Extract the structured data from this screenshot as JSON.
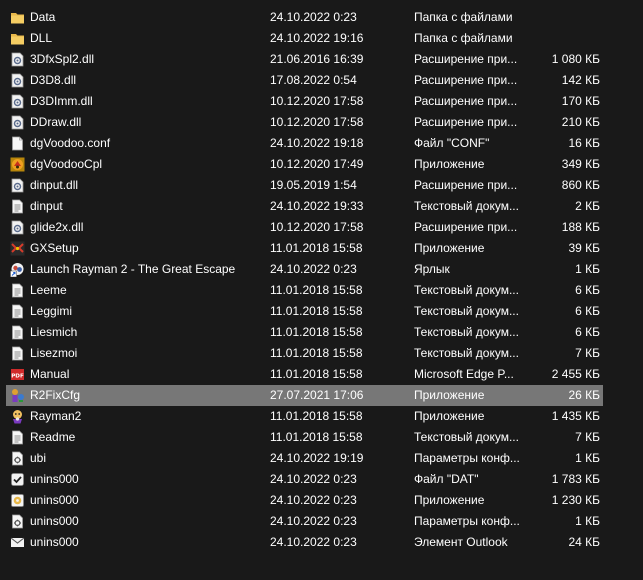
{
  "files": [
    {
      "name": "Data",
      "date": "24.10.2022 0:23",
      "type": "Папка с файлами",
      "size": "",
      "icon": "folder-icon"
    },
    {
      "name": "DLL",
      "date": "24.10.2022 19:16",
      "type": "Папка с файлами",
      "size": "",
      "icon": "folder-icon"
    },
    {
      "name": "3DfxSpl2.dll",
      "date": "21.06.2016 16:39",
      "type": "Расширение при...",
      "size": "1 080 КБ",
      "icon": "dll-file-icon"
    },
    {
      "name": "D3D8.dll",
      "date": "17.08.2022 0:54",
      "type": "Расширение при...",
      "size": "142 КБ",
      "icon": "dll-file-icon"
    },
    {
      "name": "D3DImm.dll",
      "date": "10.12.2020 17:58",
      "type": "Расширение при...",
      "size": "170 КБ",
      "icon": "dll-file-icon"
    },
    {
      "name": "DDraw.dll",
      "date": "10.12.2020 17:58",
      "type": "Расширение при...",
      "size": "210 КБ",
      "icon": "dll-file-icon"
    },
    {
      "name": "dgVoodoo.conf",
      "date": "24.10.2022 19:18",
      "type": "Файл \"CONF\"",
      "size": "16 КБ",
      "icon": "blank-file-icon"
    },
    {
      "name": "dgVoodooCpl",
      "date": "10.12.2020 17:49",
      "type": "Приложение",
      "size": "349 КБ",
      "icon": "dgvoodoo-app-icon"
    },
    {
      "name": "dinput.dll",
      "date": "19.05.2019 1:54",
      "type": "Расширение при...",
      "size": "860 КБ",
      "icon": "dll-file-icon"
    },
    {
      "name": "dinput",
      "date": "24.10.2022 19:33",
      "type": "Текстовый докум...",
      "size": "2 КБ",
      "icon": "text-file-icon"
    },
    {
      "name": "glide2x.dll",
      "date": "10.12.2020 17:58",
      "type": "Расширение при...",
      "size": "188 КБ",
      "icon": "dll-file-icon"
    },
    {
      "name": "GXSetup",
      "date": "11.01.2018 15:58",
      "type": "Приложение",
      "size": "39 КБ",
      "icon": "gxsetup-app-icon"
    },
    {
      "name": "Launch Rayman 2 - The Great Escape",
      "date": "24.10.2022 0:23",
      "type": "Ярлык",
      "size": "1 КБ",
      "icon": "shortcut-icon"
    },
    {
      "name": "Leeme",
      "date": "11.01.2018 15:58",
      "type": "Текстовый докум...",
      "size": "6 КБ",
      "icon": "text-file-icon"
    },
    {
      "name": "Leggimi",
      "date": "11.01.2018 15:58",
      "type": "Текстовый докум...",
      "size": "6 КБ",
      "icon": "text-file-icon"
    },
    {
      "name": "Liesmich",
      "date": "11.01.2018 15:58",
      "type": "Текстовый докум...",
      "size": "6 КБ",
      "icon": "text-file-icon"
    },
    {
      "name": "Lisezmoi",
      "date": "11.01.2018 15:58",
      "type": "Текстовый докум...",
      "size": "7 КБ",
      "icon": "text-file-icon"
    },
    {
      "name": "Manual",
      "date": "11.01.2018 15:58",
      "type": "Microsoft Edge P...",
      "size": "2 455 КБ",
      "icon": "pdf-file-icon"
    },
    {
      "name": "R2FixCfg",
      "date": "27.07.2021 17:06",
      "type": "Приложение",
      "size": "26 КБ",
      "icon": "r2fixcfg-app-icon",
      "selected": true
    },
    {
      "name": "Rayman2",
      "date": "11.01.2018 15:58",
      "type": "Приложение",
      "size": "1 435 КБ",
      "icon": "rayman2-app-icon"
    },
    {
      "name": "Readme",
      "date": "11.01.2018 15:58",
      "type": "Текстовый докум...",
      "size": "7 КБ",
      "icon": "text-file-icon"
    },
    {
      "name": "ubi",
      "date": "24.10.2022 19:19",
      "type": "Параметры конф...",
      "size": "1 КБ",
      "icon": "config-file-icon"
    },
    {
      "name": "unins000",
      "date": "24.10.2022 0:23",
      "type": "Файл \"DAT\"",
      "size": "1 783 КБ",
      "icon": "dat-file-icon"
    },
    {
      "name": "unins000",
      "date": "24.10.2022 0:23",
      "type": "Приложение",
      "size": "1 230 КБ",
      "icon": "uninstaller-app-icon"
    },
    {
      "name": "unins000",
      "date": "24.10.2022 0:23",
      "type": "Параметры конф...",
      "size": "1 КБ",
      "icon": "config-file-icon"
    },
    {
      "name": "unins000",
      "date": "24.10.2022 0:23",
      "type": "Элемент Outlook",
      "size": "24 КБ",
      "icon": "mail-icon"
    }
  ],
  "colors": {
    "background": "#191919",
    "text": "#ffffff",
    "selection": "#777777",
    "folder": "#e8b84a"
  }
}
